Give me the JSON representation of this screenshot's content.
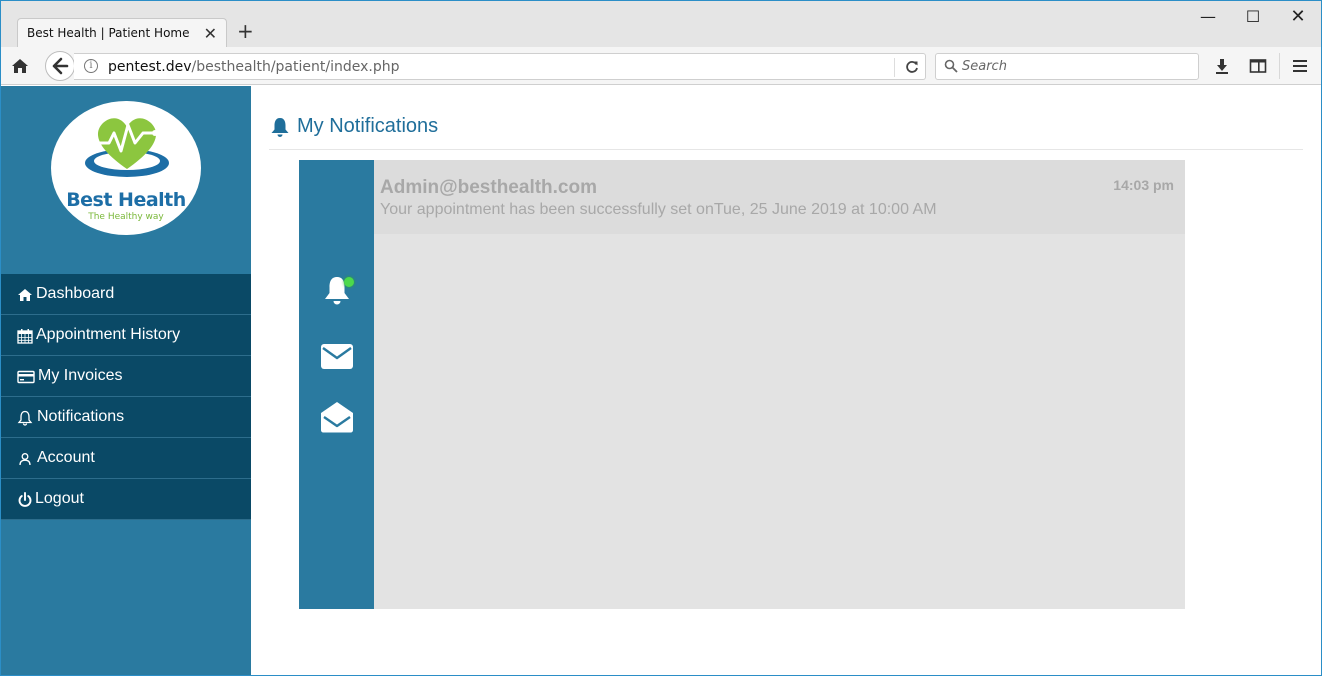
{
  "browser": {
    "tab_title": "Best Health | Patient Home",
    "tab_close": "✕",
    "new_tab": "+",
    "url_host": "pentest.dev",
    "url_path": "/besthealth/patient/index.php",
    "search_placeholder": "Search",
    "window_controls": {
      "minimize": "—",
      "maximize": "☐",
      "close": "✕"
    }
  },
  "sidebar": {
    "logo": {
      "name": "Best Health",
      "tagline": "The Healthy way",
      "colors": {
        "heart": "#8cc63f",
        "ring": "#1d6ea6"
      }
    },
    "items": [
      {
        "label": "Dashboard",
        "icon": "home-icon"
      },
      {
        "label": "Appointment History",
        "icon": "calendar-icon"
      },
      {
        "label": "My Invoices",
        "icon": "credit-card-icon"
      },
      {
        "label": "Notifications",
        "icon": "bell-outline-icon"
      },
      {
        "label": "Account",
        "icon": "user-icon"
      },
      {
        "label": "Logout",
        "icon": "power-icon"
      }
    ]
  },
  "main": {
    "title": "My Notifications",
    "title_icon": "bell-icon",
    "rail": [
      {
        "icon": "bell-icon",
        "has_unread": true
      },
      {
        "icon": "envelope-icon"
      },
      {
        "icon": "envelope-open-icon"
      }
    ],
    "notifications": [
      {
        "from": "Admin@besthealth.com",
        "time": "14:03 pm",
        "message": "Your appointment has been successfully set onTue, 25 June 2019 at 10:00 AM"
      }
    ]
  },
  "colors": {
    "sidebar_bg": "#2a7aa0",
    "menu_item_bg": "#0a4966",
    "heading": "#1f6e9a",
    "panel_bg": "#e3e3e3",
    "unread_dot": "#4cd94c"
  }
}
